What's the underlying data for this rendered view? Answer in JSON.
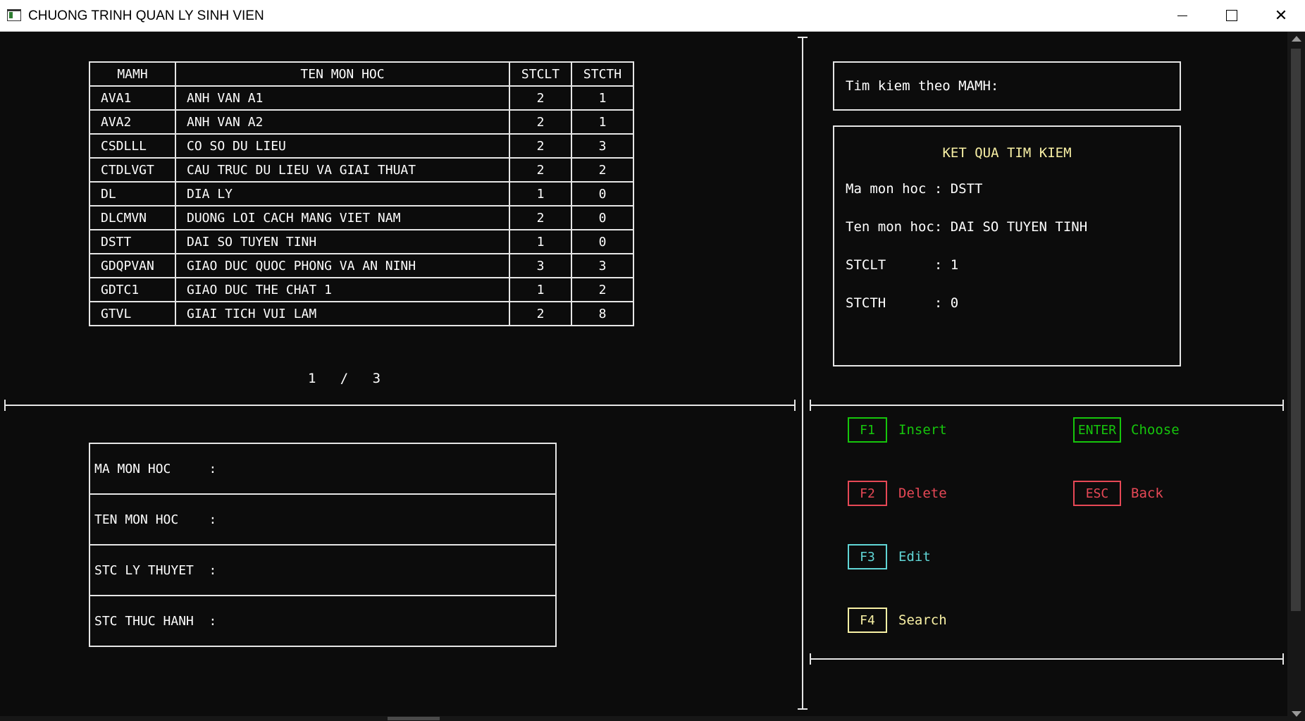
{
  "window": {
    "title": "CHUONG TRINH QUAN LY SINH VIEN",
    "controls": [
      "minimize",
      "maximize",
      "close"
    ]
  },
  "table": {
    "headers": [
      "MAMH",
      "TEN MON HOC",
      "STCLT",
      "STCTH"
    ],
    "rows": [
      [
        "AVA1",
        "ANH VAN A1",
        "2",
        "1"
      ],
      [
        "AVA2",
        "ANH VAN A2",
        "2",
        "1"
      ],
      [
        "CSDLLL",
        "CO SO DU LIEU",
        "2",
        "3"
      ],
      [
        "CTDLVGT",
        "CAU TRUC DU LIEU VA GIAI THUAT",
        "2",
        "2"
      ],
      [
        "DL",
        "DIA LY",
        "1",
        "0"
      ],
      [
        "DLCMVN",
        "DUONG LOI CACH MANG VIET NAM",
        "2",
        "0"
      ],
      [
        "DSTT",
        "DAI SO TUYEN TINH",
        "1",
        "0"
      ],
      [
        "GDQPVAN",
        "GIAO DUC QUOC PHONG VA AN NINH",
        "3",
        "3"
      ],
      [
        "GDTC1",
        "GIAO DUC THE CHAT 1",
        "1",
        "2"
      ],
      [
        "GTVL",
        "GIAI TICH VUI LAM",
        "2",
        "8"
      ]
    ]
  },
  "pager": {
    "current": "1",
    "separator": "/",
    "total": "3"
  },
  "form": {
    "ma_mon_hoc": "MA MON HOC     :",
    "ten_mon_hoc": "TEN MON HOC    :",
    "stc_ly_thuyet": "STC LY THUYET  :",
    "stc_thuc_hanh": "STC THUC HANH  :"
  },
  "search": {
    "label": "Tim kiem theo MAMH:",
    "result_title": "KET QUA TIM KIEM",
    "ma_mon_hoc": "Ma mon hoc : DSTT",
    "ten_mon_hoc": "Ten mon hoc: DAI SO TUYEN TINH",
    "stclt": "STCLT      : 1",
    "stcth": "STCTH      : 0"
  },
  "keys": {
    "f1": {
      "key": "F1",
      "label": "Insert",
      "color": "#16c60c"
    },
    "f2": {
      "key": "F2",
      "label": "Delete",
      "color": "#e74856"
    },
    "f3": {
      "key": "F3",
      "label": "Edit",
      "color": "#61d6d6"
    },
    "f4": {
      "key": "F4",
      "label": "Search",
      "color": "#f9f1a5"
    },
    "enter": {
      "key": "ENTER",
      "label": "Choose",
      "color": "#16c60c"
    },
    "esc": {
      "key": "ESC",
      "label": "Back",
      "color": "#e74856"
    }
  }
}
